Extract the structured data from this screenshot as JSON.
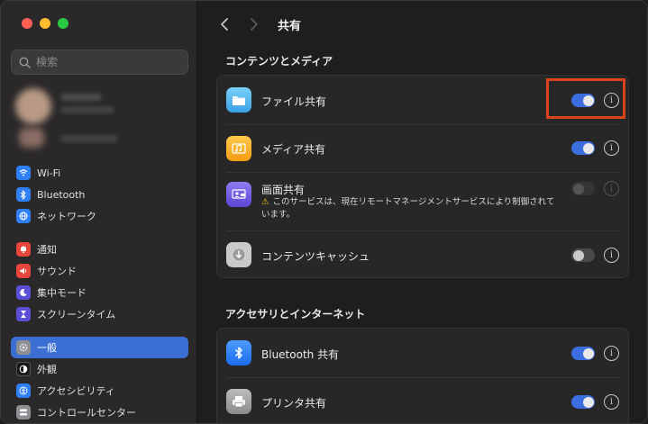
{
  "sidebar": {
    "search_placeholder": "検索",
    "items": [
      {
        "label": "Wi-Fi",
        "icon": "wifi-icon",
        "color": "#2f7ff5"
      },
      {
        "label": "Bluetooth",
        "icon": "bluetooth-icon",
        "color": "#2f7ff5"
      },
      {
        "label": "ネットワーク",
        "icon": "globe-icon",
        "color": "#2f7ff5"
      },
      {
        "label": "通知",
        "icon": "bell-icon",
        "color": "#e8453c"
      },
      {
        "label": "サウンド",
        "icon": "speaker-icon",
        "color": "#e8453c"
      },
      {
        "label": "集中モード",
        "icon": "moon-icon",
        "color": "#5a4fd6"
      },
      {
        "label": "スクリーンタイム",
        "icon": "hourglass-icon",
        "color": "#5a4fd6"
      },
      {
        "label": "一般",
        "icon": "gear-icon",
        "color": "#8e8e93"
      },
      {
        "label": "外観",
        "icon": "appearance-icon",
        "color": "#1a1a1a"
      },
      {
        "label": "アクセシビリティ",
        "icon": "accessibility-icon",
        "color": "#2f7ff5"
      },
      {
        "label": "コントロールセンター",
        "icon": "control-center-icon",
        "color": "#8e8e93"
      }
    ]
  },
  "header": {
    "title": "共有",
    "back": "<",
    "forward": ">"
  },
  "sections": {
    "content_media": "コンテンツとメディア",
    "accessories_internet": "アクセサリとインターネット"
  },
  "rows": {
    "file_sharing": {
      "label": "ファイル共有",
      "state": "on"
    },
    "media_sharing": {
      "label": "メディア共有",
      "state": "on"
    },
    "screen_sharing": {
      "label": "画面共有",
      "state": "disabled",
      "warning": "このサービスは、現在リモートマネージメントサービスにより制御されています。"
    },
    "content_caching": {
      "label": "コンテンツキャッシュ",
      "state": "off"
    },
    "bluetooth_sharing": {
      "label": "Bluetooth 共有",
      "state": "on"
    },
    "printer_sharing": {
      "label": "プリンタ共有",
      "state": "on"
    }
  },
  "info_glyph": "i",
  "warning_glyph": "⚠",
  "accent_color": "#3d6ee0",
  "highlight_color": "#d9441c"
}
